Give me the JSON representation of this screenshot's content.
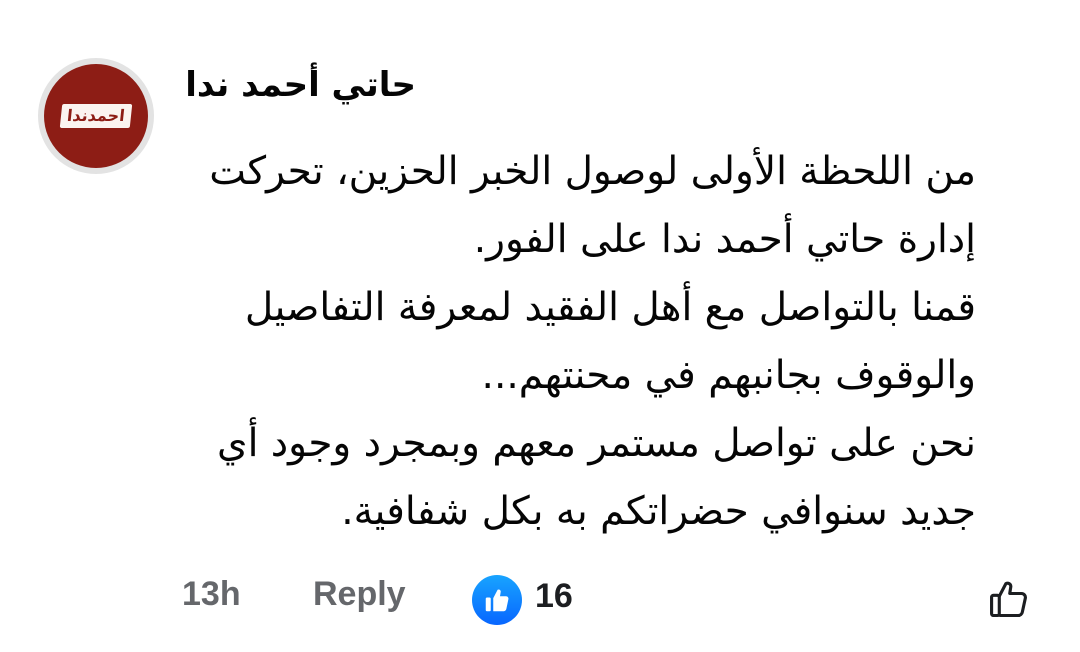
{
  "comment": {
    "avatar": {
      "logo_text": "احمدندا",
      "icon": "brand-logo",
      "colors": {
        "ring": "#e3e3e3",
        "fill": "#8d1d15",
        "label_bg": "#fbf4f0"
      }
    },
    "author_name": "حاتي أحمد ندا",
    "body_lines": [
      "من اللحظة الأولى لوصول الخبر الحزين، تحركت",
      "إدارة حاتي أحمد ندا على الفور.",
      "قمنا بالتواصل مع أهل الفقيد لمعرفة التفاصيل",
      "والوقوف بجانبهم في محنتهم...",
      "نحن على تواصل مستمر معهم وبمجرد وجود أي",
      "جديد سنوافي حضراتكم به بكل شفافية."
    ]
  },
  "actions": {
    "timestamp": "13h",
    "reply_label": "Reply",
    "reaction_count": "16",
    "reaction_icon": "like-reaction-icon",
    "like_icon": "thumbs-up-outline-icon",
    "colors": {
      "meta_text": "#65676b",
      "count_text": "#1c1e21",
      "reaction_blue": "#0866ff"
    }
  }
}
